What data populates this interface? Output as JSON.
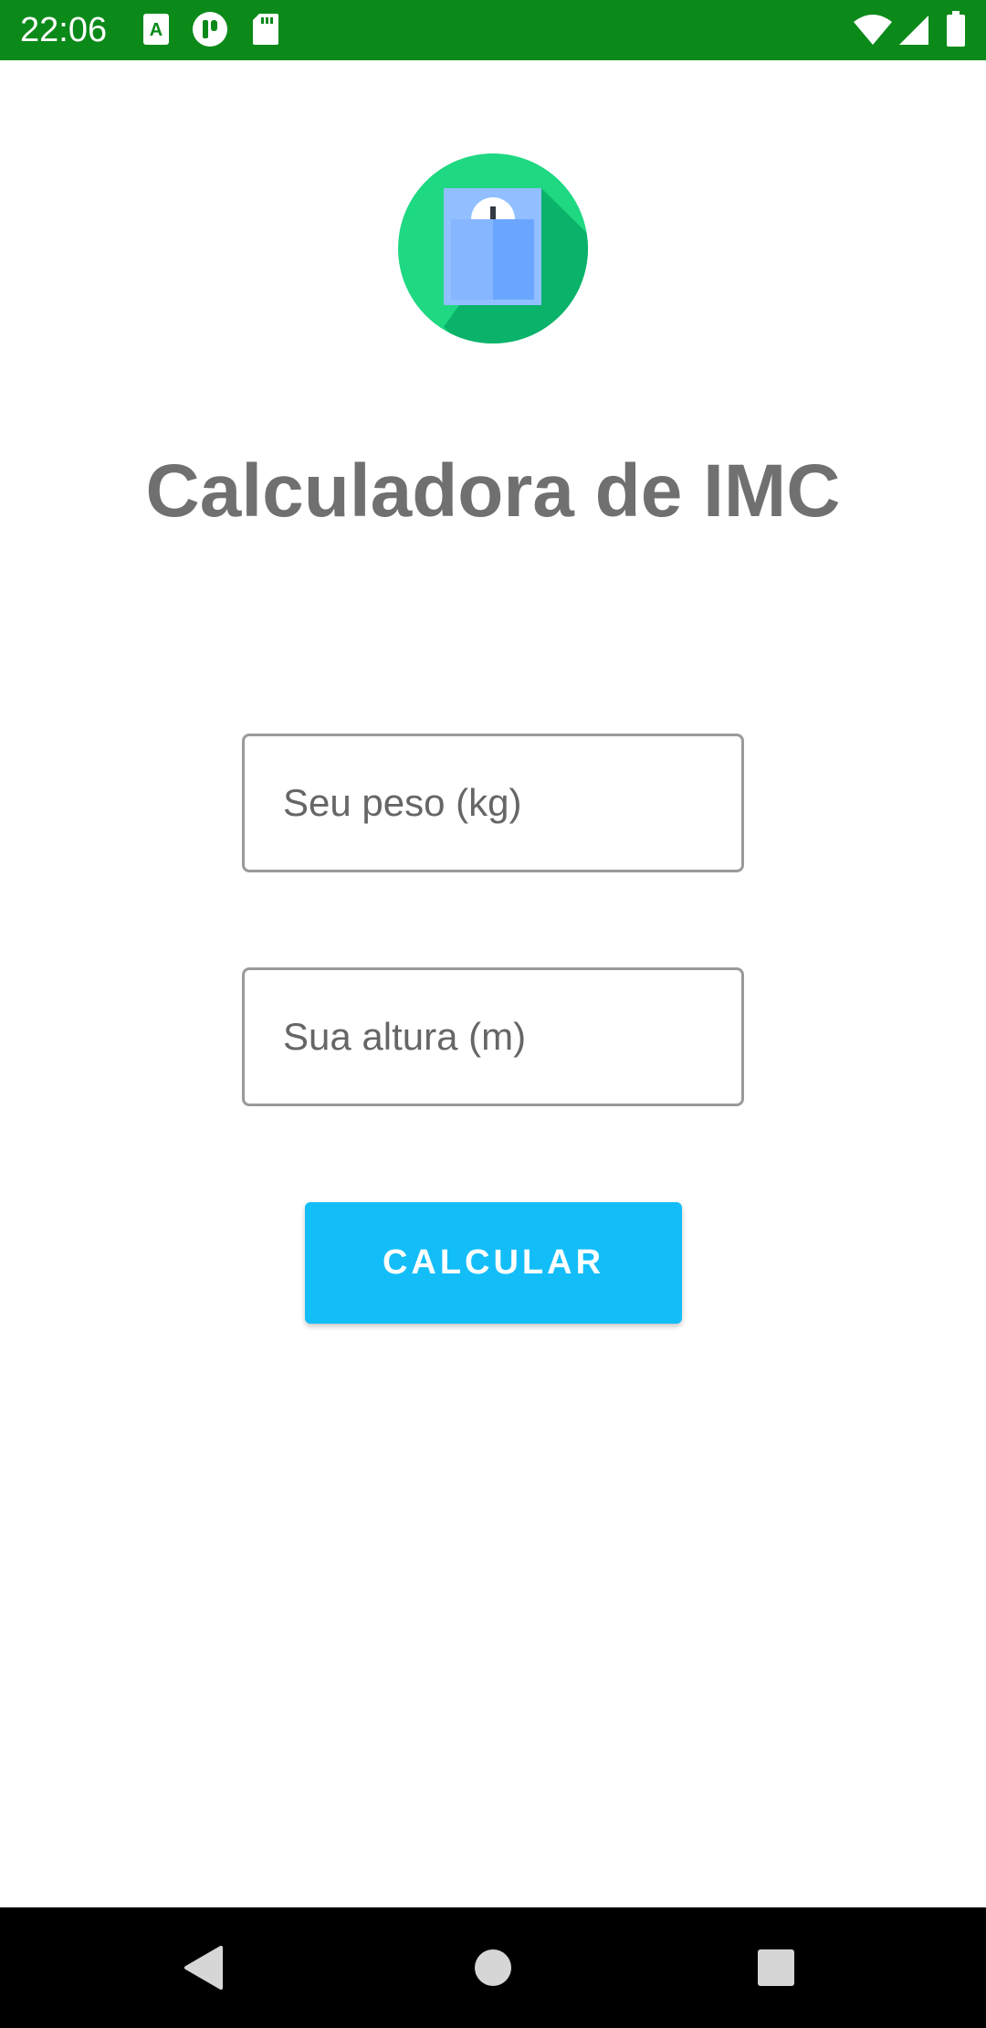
{
  "status_bar": {
    "time": "22:06",
    "background": "#0b8a1a",
    "notification_icons": [
      "app-a-icon",
      "notification-app-icon",
      "sd-card-icon"
    ],
    "system_icons": [
      "wifi-icon",
      "cell-signal-icon",
      "battery-icon"
    ]
  },
  "app": {
    "logo_icon": "scale-logo-icon",
    "title": "Calculadora de IMC",
    "weight_input": {
      "placeholder": "Seu peso (kg)",
      "value": ""
    },
    "height_input": {
      "placeholder": "Sua altura (m)",
      "value": ""
    },
    "calculate_button": {
      "label": "CALCULAR",
      "color": "#13bef8"
    }
  },
  "nav_bar": {
    "buttons": [
      "back-icon",
      "home-icon",
      "recents-icon"
    ]
  }
}
